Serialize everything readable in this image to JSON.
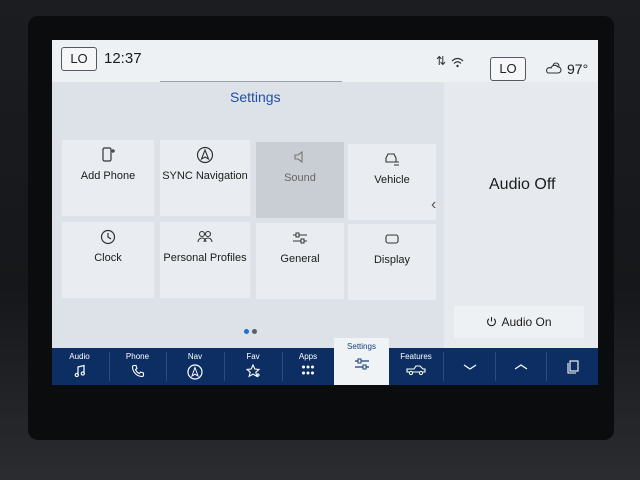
{
  "status": {
    "left_badge": "LO",
    "time": "12:37",
    "right_badge": "LO",
    "temperature": "97°"
  },
  "settings": {
    "title": "Settings",
    "tiles": [
      {
        "label": "Add Phone",
        "icon": "phone-add-icon"
      },
      {
        "label": "SYNC Navigation",
        "icon": "navigation-icon"
      },
      {
        "label": "Sound",
        "icon": "speaker-icon",
        "selected": true
      },
      {
        "label": "Vehicle",
        "icon": "vehicle-settings-icon"
      },
      {
        "label": "Clock",
        "icon": "clock-icon"
      },
      {
        "label": "Personal Profiles",
        "icon": "profiles-icon"
      },
      {
        "label": "General",
        "icon": "sliders-icon"
      },
      {
        "label": "Display",
        "icon": "display-icon"
      }
    ],
    "page_count": 2,
    "current_page": 1
  },
  "audio": {
    "status": "Audio Off",
    "button": "Audio On"
  },
  "dock": [
    {
      "label": "Audio",
      "icon": "music-note-icon"
    },
    {
      "label": "Phone",
      "icon": "phone-icon"
    },
    {
      "label": "Nav",
      "icon": "nav-icon"
    },
    {
      "label": "Fav",
      "icon": "star-icon"
    },
    {
      "label": "Apps",
      "icon": "apps-grid-icon"
    },
    {
      "label": "Settings",
      "icon": "settings-sliders-icon",
      "active": true
    },
    {
      "label": "Features",
      "icon": "truck-icon"
    }
  ],
  "colors": {
    "dock": "#0d2e63",
    "accent": "#1f4fa8",
    "page_dot_active": "#1f6fd6",
    "page_dot_inactive": "#5a5f66"
  }
}
